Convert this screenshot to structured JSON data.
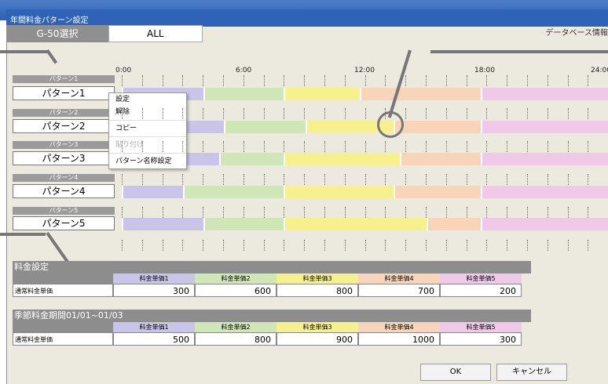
{
  "window": {
    "title": "年間料金パターン設定",
    "tab": "G-50選択",
    "selected": "ALL",
    "db_info": "データベース情報"
  },
  "timeline": {
    "ticks": [
      "0:00",
      "6:00",
      "12:00",
      "18:00",
      "24:00"
    ]
  },
  "patterns": [
    {
      "short": "パターン1",
      "name": "パターン1"
    },
    {
      "short": "パターン2",
      "name": "パターン2"
    },
    {
      "short": "パターン3",
      "name": "パターン3"
    },
    {
      "short": "パターン4",
      "name": "パターン4"
    },
    {
      "short": "パターン5",
      "name": "パターン5"
    }
  ],
  "context_menu": {
    "items": [
      "設定",
      "解除",
      "コピー",
      "貼り付け",
      "パターン名称設定"
    ],
    "disabled": [
      false,
      false,
      false,
      true,
      false
    ]
  },
  "rate_setting": {
    "title": "料金設定",
    "headers": [
      "料金単価1",
      "料金単価2",
      "料金単価3",
      "料金単価4",
      "料金単価5"
    ],
    "row_label": "通常料金単価",
    "values": [
      "300",
      "600",
      "800",
      "700",
      "200"
    ]
  },
  "season_setting": {
    "title": "季節料金期間01/01~01/03",
    "headers": [
      "料金単価1",
      "料金単価2",
      "料金単価3",
      "料金単価4",
      "料金単価5"
    ],
    "row_label": "通常料金単価",
    "values": [
      "500",
      "800",
      "900",
      "1000",
      "300"
    ]
  },
  "buttons": {
    "ok": "OK",
    "cancel": "キャンセル"
  },
  "colors": {
    "c1": "#c9c5ea",
    "c2": "#cfe6b7",
    "c3": "#f6f08d",
    "c4": "#f8d5b8",
    "c5": "#f0c9e8",
    "header": "#8d8d8d"
  }
}
